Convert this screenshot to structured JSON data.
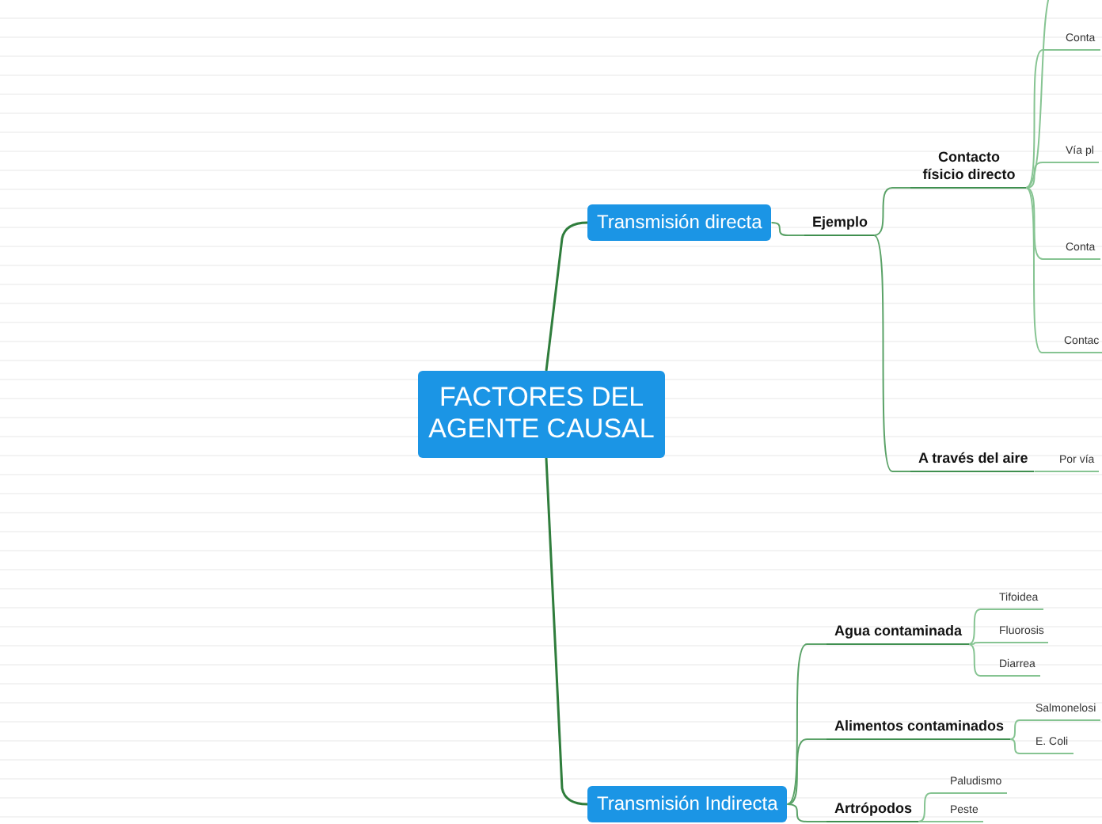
{
  "mind_map": {
    "kind": "root",
    "text": "FACTORES DEL AGENTE CAUSAL",
    "children": [
      {
        "kind": "topic",
        "text": "Transmisión directa",
        "children": [
          {
            "kind": "subtopic",
            "text": "Ejemplo",
            "children": [
              {
                "kind": "subtopic",
                "text": "Contacto físicio directo",
                "children": [
                  {
                    "kind": "leaf",
                    "text": "Conta"
                  },
                  {
                    "kind": "leaf",
                    "text": "Vía pl"
                  },
                  {
                    "kind": "leaf",
                    "text": "Conta"
                  },
                  {
                    "kind": "leaf",
                    "text": "Contac"
                  }
                ]
              },
              {
                "kind": "subtopic",
                "text": "A través del aire",
                "children": [
                  {
                    "kind": "leaf",
                    "text": "Por vía"
                  }
                ]
              }
            ]
          }
        ]
      },
      {
        "kind": "topic",
        "text": "Transmisión Indirecta",
        "children": [
          {
            "kind": "subtopic",
            "text": "Agua contaminada",
            "children": [
              {
                "kind": "leaf",
                "text": "Tifoidea"
              },
              {
                "kind": "leaf",
                "text": "Fluorosis"
              },
              {
                "kind": "leaf",
                "text": "Diarrea"
              }
            ]
          },
          {
            "kind": "subtopic",
            "text": "Alimentos contaminados",
            "children": [
              {
                "kind": "leaf",
                "text": "Salmonelosi"
              },
              {
                "kind": "leaf",
                "text": "E. Coli"
              }
            ]
          },
          {
            "kind": "subtopic",
            "text": "Artrópodos",
            "children": [
              {
                "kind": "leaf",
                "text": "Paludismo"
              },
              {
                "kind": "leaf",
                "text": "Peste"
              }
            ]
          }
        ]
      }
    ]
  }
}
